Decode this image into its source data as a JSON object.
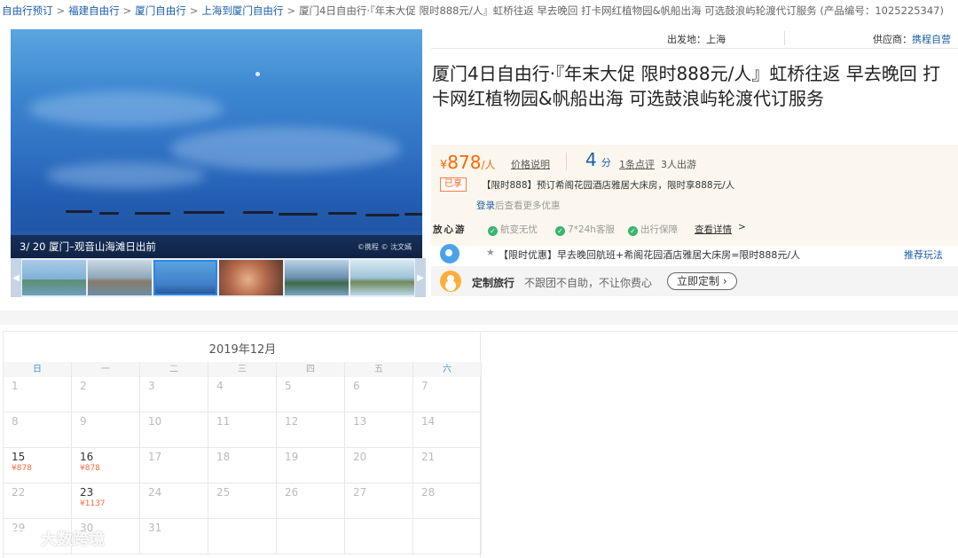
{
  "breadcrumb": {
    "links": [
      "自由行预订",
      "福建自由行",
      "厦门自由行",
      "上海到厦门自由行"
    ],
    "current": "厦门4日自由行·『年末大促 限时888元/人』虹桥往返 早去晚回 打卡网红植物园&帆船出海 可选鼓浪屿轮渡代订服务 (产品编号：1025225347)"
  },
  "gallery": {
    "caption": "3/ 20 厦门–观音山海滩日出前",
    "watermark": "©携程 © 沈文嫣",
    "thumbnail_colors": [
      "#7fb0d6",
      "#8fa7b8",
      "#3f7fc8",
      "#b4684c",
      "#6a8fae",
      "#9ec3d8"
    ],
    "active_index": 2
  },
  "header": {
    "departure_label": "出发地：上海",
    "supplier_label": "供应商：",
    "supplier_value": "携程自营"
  },
  "title": "厦门4日自由行·『年末大促 限时888元/人』虹桥往返 早去晚回 打卡网红植物园&帆船出海 可选鼓浪屿轮渡代订服务",
  "price": {
    "currency": "¥",
    "value": "878",
    "unit": "/人",
    "explain_link": "价格说明",
    "score": "4",
    "score_unit": "分",
    "review_link": "1条点评",
    "travelers": "3人出游"
  },
  "promo": {
    "tag": "已享",
    "text": "【限时888】预订希阁花园酒店雅居大床房，限时享888元/人",
    "login_link": "登录",
    "login_suffix": "后查看更多优惠"
  },
  "assurance": {
    "label": "放心游",
    "items": [
      "航变无忧",
      "7*24h客服",
      "出行保障"
    ],
    "details_link": "查看详情",
    "chevron": ">"
  },
  "limited_offer": {
    "star": "★",
    "text": "【限时优惠】早去晚回航班+希阁花园酒店雅居大床房=限时888元/人",
    "recommend_link": "推荐玩法"
  },
  "custom_travel": {
    "name": "定制旅行",
    "slogan": "不跟团不自助，不让你费心",
    "button": "立即定制 ›"
  },
  "calendar": {
    "month": "2019年12月",
    "weekdays": [
      "日",
      "一",
      "二",
      "三",
      "四",
      "五",
      "六"
    ],
    "rows": [
      [
        {
          "d": "1"
        },
        {
          "d": "2"
        },
        {
          "d": "3"
        },
        {
          "d": "4"
        },
        {
          "d": "5"
        },
        {
          "d": "6"
        },
        {
          "d": "7"
        }
      ],
      [
        {
          "d": "8"
        },
        {
          "d": "9"
        },
        {
          "d": "10"
        },
        {
          "d": "11"
        },
        {
          "d": "12"
        },
        {
          "d": "13"
        },
        {
          "d": "14"
        }
      ],
      [
        {
          "d": "15",
          "p": "¥878"
        },
        {
          "d": "16",
          "p": "¥878"
        },
        {
          "d": "17"
        },
        {
          "d": "18"
        },
        {
          "d": "19"
        },
        {
          "d": "20"
        },
        {
          "d": "21"
        }
      ],
      [
        {
          "d": "22"
        },
        {
          "d": "23",
          "p": "¥1137"
        },
        {
          "d": "24"
        },
        {
          "d": "25"
        },
        {
          "d": "26"
        },
        {
          "d": "27"
        },
        {
          "d": "28"
        }
      ],
      [
        {
          "d": "29"
        },
        {
          "d": "30"
        },
        {
          "d": "31"
        },
        {
          "d": ""
        },
        {
          "d": ""
        },
        {
          "d": ""
        },
        {
          "d": ""
        }
      ]
    ]
  },
  "brand_watermark": "大数跨境"
}
